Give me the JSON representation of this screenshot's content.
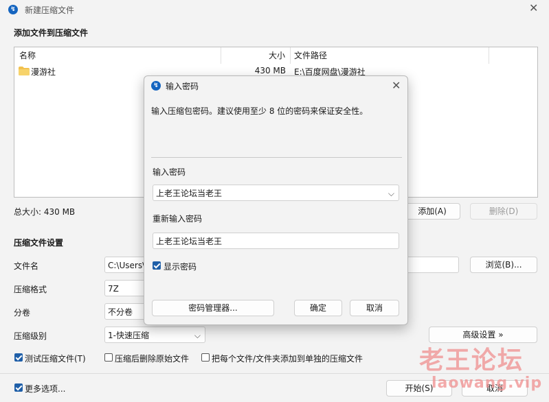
{
  "window": {
    "title": "新建压缩文件",
    "close": "✕"
  },
  "add_files": {
    "heading": "添加文件到压缩文件",
    "columns": [
      "名称",
      "大小",
      "文件路径"
    ],
    "rows": [
      {
        "name": "漫游社",
        "size": "430 MB",
        "path": "E:\\百度网盘\\漫游社"
      }
    ],
    "total_size": "总大小: 430 MB",
    "add_button": "添加(A)",
    "remove_button": "删除(D)"
  },
  "settings": {
    "heading": "压缩文件设置",
    "filename_label": "文件名",
    "filename_value": "C:\\Users\\",
    "browse_button": "浏览(B)...",
    "format_label": "压缩格式",
    "format_value": "7Z",
    "split_label": "分卷",
    "split_value": "不分卷",
    "level_label": "压缩级别",
    "level_value": "1-快速压缩",
    "advanced_button": "高级设置 »",
    "test_label": "测试压缩文件(T)",
    "delete_label": "压缩后删除原始文件",
    "separate_label": "把每个文件/文件夹添加到单独的压缩文件"
  },
  "footer": {
    "more_label": "更多选项...",
    "start_button": "开始(S)",
    "cancel_button": "取消"
  },
  "dialog": {
    "title": "输入密码",
    "close": "✕",
    "description": "输入压缩包密码。建议使用至少 8 位的密码来保证安全性。",
    "password_label": "输入密码",
    "password_value": "上老王论坛当老王",
    "reenter_label": "重新输入密码",
    "reenter_value": "上老王论坛当老王",
    "show_label": "显示密码",
    "manager_button": "密码管理器...",
    "ok_button": "确定",
    "cancel_button": "取消"
  },
  "watermark": {
    "line1": "老王论坛",
    "line2": "laowang.vip"
  },
  "colors": {
    "accent": "#1f5fa8",
    "folder": "#f2c14e",
    "watermark": "#f08f8f"
  }
}
